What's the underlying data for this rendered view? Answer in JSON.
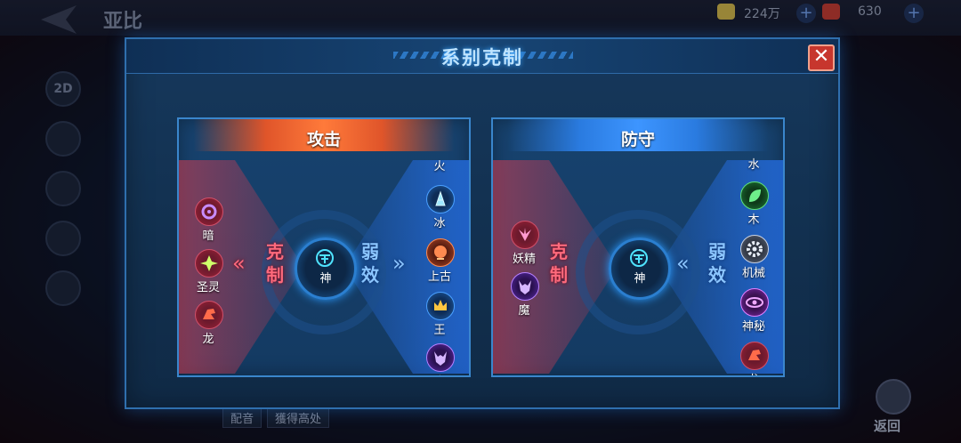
{
  "background": {
    "title": "亚比",
    "resources": [
      {
        "name": "gold",
        "value": "224万"
      },
      {
        "name": "gems",
        "value": "630"
      }
    ],
    "side_buttons": [
      "2D"
    ],
    "bottom": {
      "dub_label": "配音",
      "gain_label": "獲得高处"
    },
    "return_label": "返回"
  },
  "modal": {
    "title": "系别克制",
    "close": "✕"
  },
  "attack_panel": {
    "header": "攻击",
    "restrain_label": "克制",
    "weak_label": "弱效",
    "center": "神",
    "restrains": [
      "暗",
      "圣灵",
      "龙"
    ],
    "weak": [
      "火",
      "冰",
      "上古",
      "王",
      "魔"
    ]
  },
  "defense_panel": {
    "header": "防守",
    "restrain_label": "克制",
    "weak_label": "弱效",
    "center": "神",
    "restrains": [
      "妖精",
      "魔"
    ],
    "weak": [
      "水",
      "木",
      "机械",
      "神秘",
      "龙"
    ]
  },
  "colors": {
    "attack_header": "#e0552a",
    "defense_header": "#2a7be0",
    "restrain": "#ff6a7c",
    "weak": "#8cc6ff"
  }
}
